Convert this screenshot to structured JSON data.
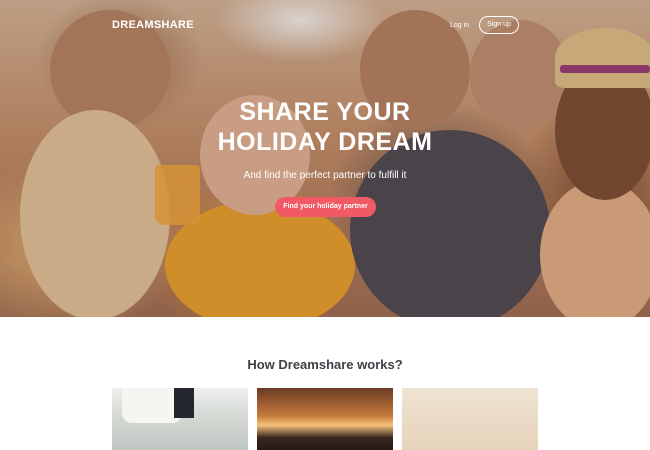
{
  "nav": {
    "logo": "DREAMSHARE",
    "login_label": "Log in",
    "signup_label": "Sign up"
  },
  "hero": {
    "title_line1": "SHARE YOUR",
    "title_line2": "HOLIDAY DREAM",
    "subtitle": "And find the perfect partner to fulfill it",
    "cta_label": "Find your holiday partner"
  },
  "how": {
    "title": "How Dreamshare works?"
  },
  "colors": {
    "accent": "#f15a64",
    "heading": "#3f3f46"
  }
}
